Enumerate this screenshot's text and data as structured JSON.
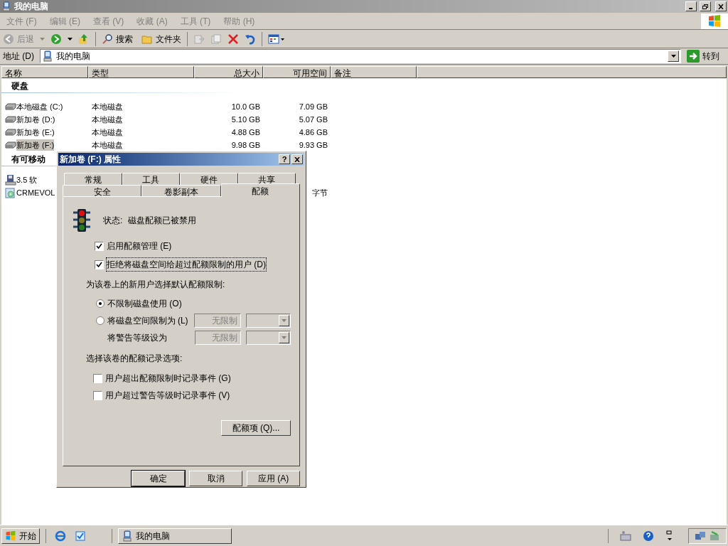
{
  "window": {
    "title": "我的电脑"
  },
  "menu": [
    {
      "label": "文件 (F)"
    },
    {
      "label": "编辑 (E)"
    },
    {
      "label": "查看 (V)"
    },
    {
      "label": "收藏 (A)"
    },
    {
      "label": "工具 (T)"
    },
    {
      "label": "帮助 (H)"
    }
  ],
  "toolbar": {
    "back": "后退",
    "search": "搜索",
    "folders": "文件夹"
  },
  "address": {
    "label": "地址 (D)",
    "value": "我的电脑",
    "go": "转到"
  },
  "columns": [
    "名称",
    "类型",
    "总大小",
    "可用空间",
    "备注"
  ],
  "groups": [
    {
      "title": "硬盘",
      "items": [
        {
          "kind": "hdd",
          "name": "本地磁盘 (C:)",
          "type": "本地磁盘",
          "total": "10.0 GB",
          "free": "7.09 GB",
          "selected": false
        },
        {
          "kind": "hdd",
          "name": "新加卷 (D:)",
          "type": "本地磁盘",
          "total": "5.10 GB",
          "free": "5.07 GB",
          "selected": false
        },
        {
          "kind": "hdd",
          "name": "新加卷 (E:)",
          "type": "本地磁盘",
          "total": "4.88 GB",
          "free": "4.86 GB",
          "selected": false
        },
        {
          "kind": "hdd",
          "name": "新加卷 (F:)",
          "type": "本地磁盘",
          "total": "9.98 GB",
          "free": "9.93 GB",
          "selected": true
        }
      ]
    },
    {
      "title": "有可移动",
      "items": [
        {
          "kind": "floppy",
          "name": "3.5 软",
          "selected": false
        },
        {
          "kind": "cd",
          "name": "CRMEVOL",
          "free": "字节",
          "selected": false
        }
      ]
    }
  ],
  "dialog": {
    "title": "新加卷 (F:) 属性",
    "help": "?",
    "tab_rows": [
      [
        {
          "label": "常规",
          "selected": false
        },
        {
          "label": "工具",
          "selected": false
        },
        {
          "label": "硬件",
          "selected": false
        },
        {
          "label": "共享",
          "selected": false
        }
      ],
      [
        {
          "label": "安全",
          "selected": false
        },
        {
          "label": "卷影副本",
          "selected": false
        },
        {
          "label": "配额",
          "selected": true
        }
      ]
    ],
    "status_label": "状态:",
    "status": "磁盘配额已被禁用",
    "checkboxes": [
      {
        "label": "启用配额管理 (E)",
        "checked": true
      },
      {
        "label": "拒绝将磁盘空间给超过配额限制的用户 (D)",
        "checked": true
      }
    ],
    "default_label": "为该卷上的新用户选择默认配额限制:",
    "radios": [
      {
        "label": "不限制磁盘使用 (O)",
        "selected": true
      },
      {
        "label": "将磁盘空间限制为 (L)",
        "selected": false,
        "field": "无限制"
      }
    ],
    "warning": {
      "label": "将警告等级设为",
      "field": "无限制"
    },
    "log_label": "选择该卷的配额记录选项:",
    "log_checkboxes": [
      {
        "label": "用户超出配额限制时记录事件 (G)",
        "checked": false
      },
      {
        "label": "用户超过警告等级时记录事件 (V)",
        "checked": false
      }
    ],
    "entries_button": "配额项 (Q)...",
    "buttons": [
      "确定",
      "取消",
      "应用 (A)"
    ]
  },
  "taskbar": {
    "start": "开始",
    "task": "我的电脑"
  }
}
